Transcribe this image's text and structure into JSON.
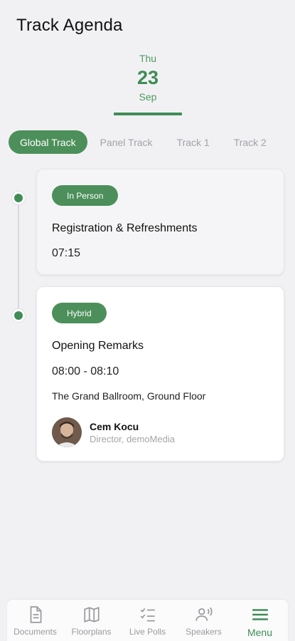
{
  "header": {
    "title": "Track Agenda"
  },
  "date_tab": {
    "weekday": "Thu",
    "day": "23",
    "month": "Sep"
  },
  "tracks": [
    {
      "label": "Global Track",
      "active": true
    },
    {
      "label": "Panel Track",
      "active": false
    },
    {
      "label": "Track 1",
      "active": false
    },
    {
      "label": "Track 2",
      "active": false
    }
  ],
  "sessions": [
    {
      "badge": "In Person",
      "title": "Registration & Refreshments",
      "time": "07:15"
    },
    {
      "badge": "Hybrid",
      "title": "Opening Remarks",
      "time": "08:00 - 08:10",
      "location": "The Grand Ballroom, Ground Floor",
      "speaker": {
        "name": "Cem Kocu",
        "role": "Director, demoMedia"
      }
    }
  ],
  "bottom_nav": [
    {
      "label": "Documents",
      "icon": "document-icon"
    },
    {
      "label": "Floorplans",
      "icon": "map-icon"
    },
    {
      "label": "Live Polls",
      "icon": "checklist-icon"
    },
    {
      "label": "Speakers",
      "icon": "speaker-icon"
    },
    {
      "label": "Menu",
      "icon": "menu-icon",
      "active": true
    }
  ],
  "colors": {
    "accent": "#3f8c56",
    "chip_active": "#4c8f5a",
    "background": "#f1f1f4"
  }
}
